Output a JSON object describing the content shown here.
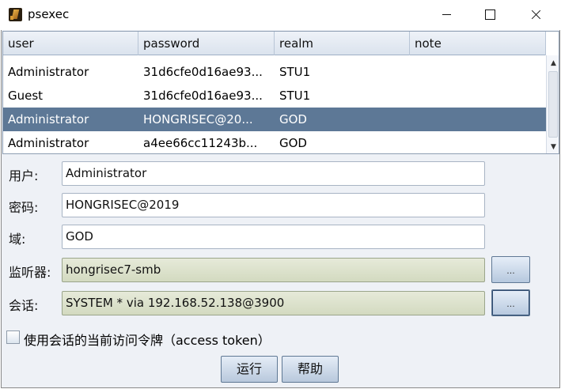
{
  "window": {
    "title": "psexec"
  },
  "table": {
    "columns": [
      "user",
      "password",
      "realm",
      "note"
    ],
    "rows": [
      {
        "user": "Administrator",
        "password": "31d6cfe0d16ae93...",
        "realm": "STU1",
        "note": ""
      },
      {
        "user": "Guest",
        "password": "31d6cfe0d16ae93...",
        "realm": "STU1",
        "note": ""
      },
      {
        "user": "Administrator",
        "password": "HONGRISEC@20...",
        "realm": "GOD",
        "note": "",
        "selected": true
      },
      {
        "user": "Administrator",
        "password": "a4ee66cc11243b...",
        "realm": "GOD",
        "note": ""
      }
    ]
  },
  "form": {
    "user_label": "用户:",
    "user_value": "Administrator",
    "password_label": "密码:",
    "password_value": "HONGRISEC@2019",
    "domain_label": "域:",
    "domain_value": "GOD",
    "listener_label": "监听器:",
    "listener_value": "hongrisec7-smb",
    "session_label": "会话:",
    "session_value": "SYSTEM * via  192.168.52.138@3900",
    "browse_label": "...",
    "checkbox_label": "使用会话的当前访问令牌（access token）",
    "checkbox_checked": false
  },
  "buttons": {
    "run": "运行",
    "help": "帮助"
  },
  "colors": {
    "selection": "#5d7896",
    "readonly_field": "#d3dac0"
  }
}
